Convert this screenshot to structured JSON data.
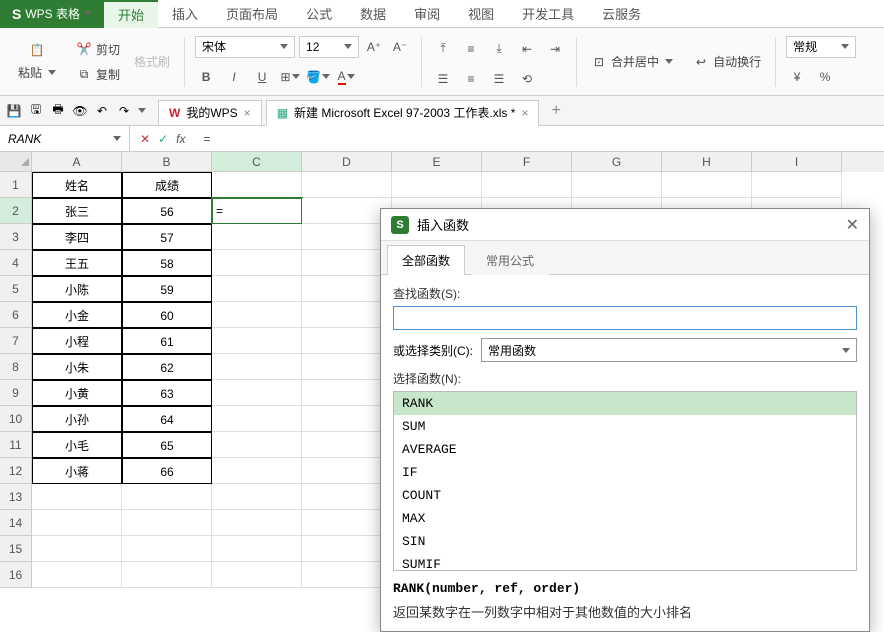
{
  "app": {
    "name": "WPS 表格"
  },
  "menu": {
    "tabs": [
      "开始",
      "插入",
      "页面布局",
      "公式",
      "数据",
      "审阅",
      "视图",
      "开发工具",
      "云服务"
    ],
    "active": 0
  },
  "ribbon": {
    "cut": "剪切",
    "copy": "复制",
    "paste": "粘贴",
    "format_painter": "格式刷",
    "font": "宋体",
    "size": "12",
    "merge": "合并居中",
    "wrap": "自动换行",
    "num_format": "常规"
  },
  "doctabs": {
    "t1": "我的WPS",
    "t2": "新建 Microsoft Excel 97-2003 工作表.xls *"
  },
  "namebox": "RANK",
  "formula": "=",
  "columns": [
    "A",
    "B",
    "C",
    "D",
    "E",
    "F",
    "G",
    "H",
    "I"
  ],
  "active_col": 2,
  "active_row": 1,
  "active_cell_val": "=",
  "chart_data": {
    "type": "table",
    "columns": [
      "姓名",
      "成绩"
    ],
    "rows": [
      [
        "张三",
        56
      ],
      [
        "李四",
        57
      ],
      [
        "王五",
        58
      ],
      [
        "小陈",
        59
      ],
      [
        "小金",
        60
      ],
      [
        "小程",
        61
      ],
      [
        "小朱",
        62
      ],
      [
        "小黄",
        63
      ],
      [
        "小孙",
        64
      ],
      [
        "小毛",
        65
      ],
      [
        "小蒋",
        66
      ]
    ]
  },
  "row_count": 16,
  "dialog": {
    "title": "插入函数",
    "tab1": "全部函数",
    "tab2": "常用公式",
    "search_label": "查找函数(S):",
    "cat_label": "或选择类别(C):",
    "cat_value": "常用函数",
    "sel_label": "选择函数(N):",
    "functions": [
      "RANK",
      "SUM",
      "AVERAGE",
      "IF",
      "COUNT",
      "MAX",
      "SIN",
      "SUMIF"
    ],
    "selected": 0,
    "signature": "RANK(number, ref, order)",
    "description": "返回某数字在一列数字中相对于其他数值的大小排名"
  }
}
